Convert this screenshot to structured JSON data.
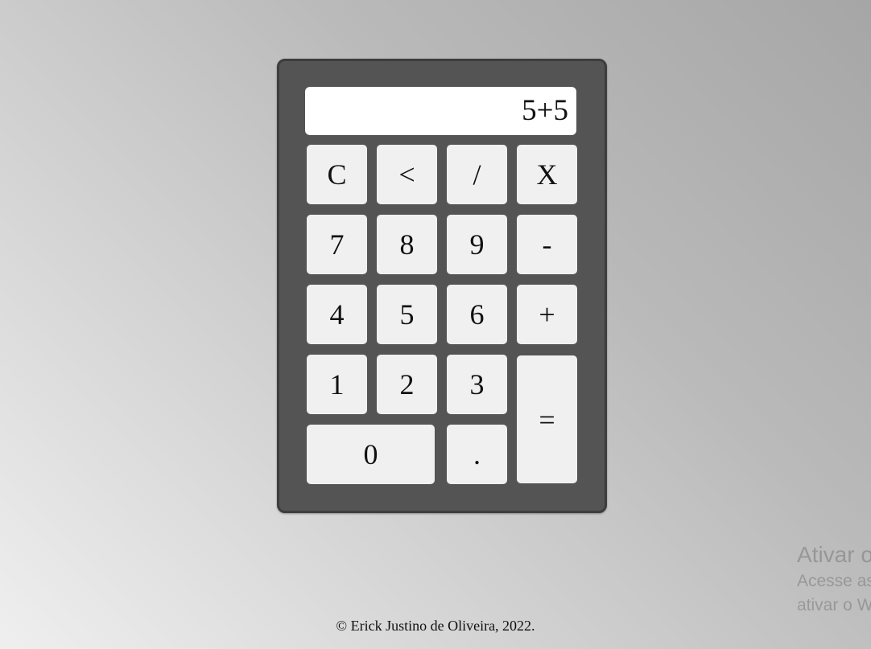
{
  "calculator": {
    "display_value": "5+5",
    "keys": {
      "clear": "C",
      "backspace": "<",
      "divide": "/",
      "multiply": "X",
      "seven": "7",
      "eight": "8",
      "nine": "9",
      "minus": "-",
      "four": "4",
      "five": "5",
      "six": "6",
      "plus": "+",
      "one": "1",
      "two": "2",
      "three": "3",
      "equals": "=",
      "zero": "0",
      "decimal": "."
    }
  },
  "footer": {
    "text": "© Erick Justino de Oliveira, 2022."
  },
  "watermark": {
    "title": "Ativar o Windows",
    "line1": "Acesse as Configurações para",
    "line2": "ativar o Windows."
  },
  "colors": {
    "calculator_body": "#545454",
    "key_background": "#f0f0f0",
    "display_background": "#ffffff"
  }
}
